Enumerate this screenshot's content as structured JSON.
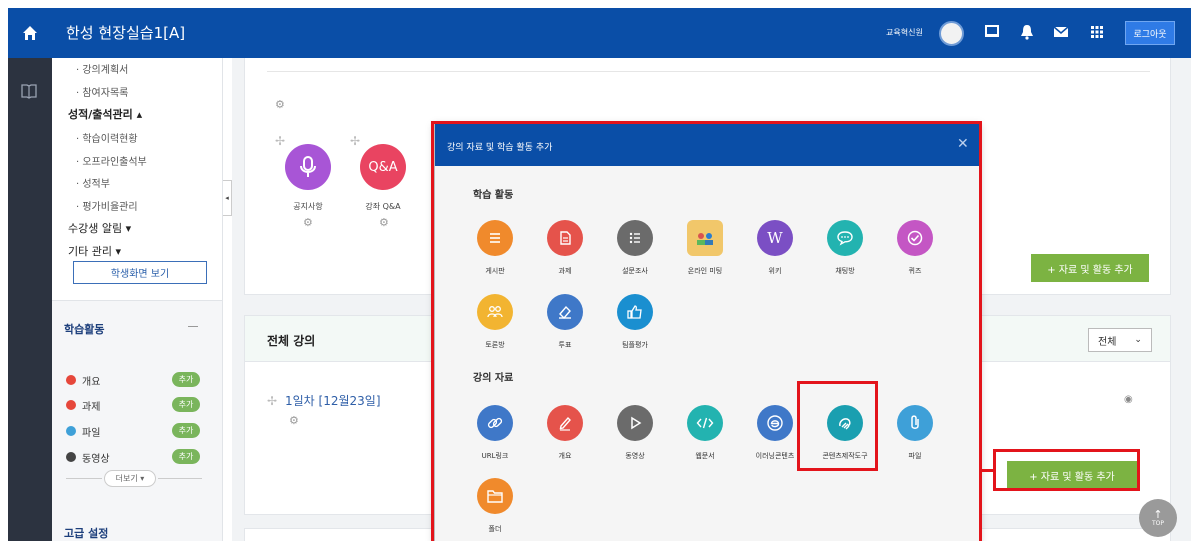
{
  "header": {
    "title": "한성 현장실습1[A]",
    "user_name": "교육혁신원",
    "login_label": "로그아웃"
  },
  "sidebar": {
    "sub_items_top": [
      "· 강의계획서",
      "· 참여자목록"
    ],
    "grade_menu": "성적/출석관리 ▴",
    "grade_items": [
      "· 학습이력현황",
      "· 오프라인출석부",
      "· 성적부",
      "· 평가비율관리"
    ],
    "notify_menu": "수강생 알림 ▾",
    "etc_menu": "기타 관리 ▾",
    "student_view_button": "학생화면 보기",
    "activity_panel_title": "학습활동",
    "activities": [
      {
        "label": "개요",
        "add": "추가",
        "color": "#e6473b"
      },
      {
        "label": "과제",
        "add": "추가",
        "color": "#e6473b"
      },
      {
        "label": "파일",
        "add": "추가",
        "color": "#3ea0d8"
      },
      {
        "label": "동영상",
        "add": "추가",
        "color": "#444444"
      }
    ],
    "more_button": "더보기 ▾",
    "advanced_title": "고급 설정"
  },
  "main": {
    "top_items": [
      {
        "label": "공지사항",
        "icon": "mic-icon",
        "text": "",
        "color": "#a855d6"
      },
      {
        "label": "강좌 Q&A",
        "icon": "qna-icon",
        "text": "Q&A",
        "color": "#e94461"
      }
    ],
    "add_button": "+ 자료 및 활동 추가",
    "section_title": "전체 강의",
    "filter_value": "전체",
    "week_title": "1일차 [12월23일]"
  },
  "modal": {
    "title": "강의 자료 및 학습 활동 추가",
    "activities_title": "학습 활동",
    "activities": [
      {
        "label": "게시판",
        "icon": "board-icon",
        "color": "#f08a2c"
      },
      {
        "label": "과제",
        "icon": "assignment-icon",
        "color": "#e5534b"
      },
      {
        "label": "설문조사",
        "icon": "survey-icon",
        "color": "#6b6b6b"
      },
      {
        "label": "온라인 미팅",
        "icon": "meeting-icon",
        "color": "#f1c76a"
      },
      {
        "label": "위키",
        "icon": "wiki-icon",
        "color": "#7b4fc4"
      },
      {
        "label": "채팅방",
        "icon": "chat-icon",
        "color": "#23b3b0"
      },
      {
        "label": "퀴즈",
        "icon": "quiz-icon",
        "color": "#c456c4"
      },
      {
        "label": "토론방",
        "icon": "discussion-icon",
        "color": "#f2b431"
      },
      {
        "label": "투표",
        "icon": "vote-icon",
        "color": "#3f78c8"
      },
      {
        "label": "팀플평가",
        "icon": "team-eval-icon",
        "color": "#1a8fd0"
      }
    ],
    "resources_title": "강의 자료",
    "resources": [
      {
        "label": "URL링크",
        "icon": "link-icon",
        "color": "#3f78c8"
      },
      {
        "label": "개요",
        "icon": "edit-icon",
        "color": "#e5534b"
      },
      {
        "label": "동영상",
        "icon": "play-icon",
        "color": "#6b6b6b"
      },
      {
        "label": "웹문서",
        "icon": "code-icon",
        "color": "#23b3b0"
      },
      {
        "label": "이러닝콘텐츠",
        "icon": "elearning-icon",
        "color": "#3f78c8"
      },
      {
        "label": "콘텐츠제작도구",
        "icon": "content-tool-icon",
        "color": "#1a9fb0"
      },
      {
        "label": "파일",
        "icon": "file-icon",
        "color": "#3ea0d8"
      },
      {
        "label": "폴더",
        "icon": "folder-icon",
        "color": "#f08a2c"
      }
    ]
  },
  "top_button": "TOP"
}
